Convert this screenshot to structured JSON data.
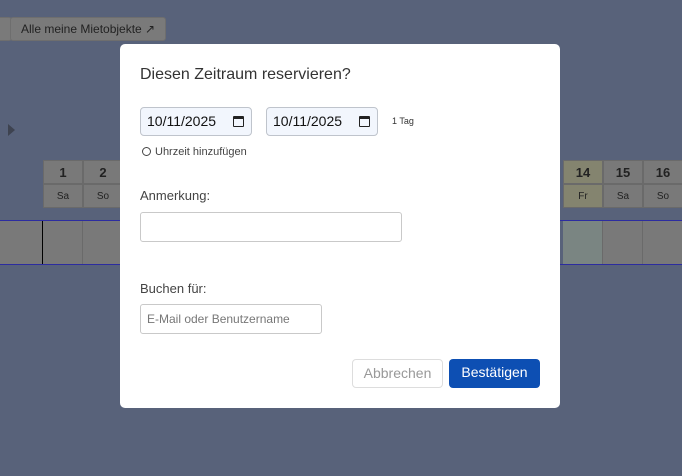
{
  "toolbar": {
    "all_objects_label": "Alle meine Mietobjekte ↗"
  },
  "calendar": {
    "left": [
      {
        "num": "1",
        "day": "Sa"
      },
      {
        "num": "2",
        "day": "So"
      }
    ],
    "right": [
      {
        "num": "14",
        "day": "Fr"
      },
      {
        "num": "15",
        "day": "Sa"
      },
      {
        "num": "16",
        "day": "So"
      }
    ]
  },
  "modal": {
    "title": "Diesen Zeitraum reservieren?",
    "start_date": "10/11/2025",
    "end_date": "10/11/2025",
    "duration": "1 Tag",
    "add_time": "Uhrzeit hinzufügen",
    "note_label": "Anmerkung:",
    "note_value": "",
    "book_for_label": "Buchen für:",
    "book_for_placeholder": "E-Mail oder Benutzername",
    "cancel": "Abbrechen",
    "confirm": "Bestätigen"
  },
  "colors": {
    "primary": "#0d4fb3",
    "overlay": "#58627a"
  }
}
